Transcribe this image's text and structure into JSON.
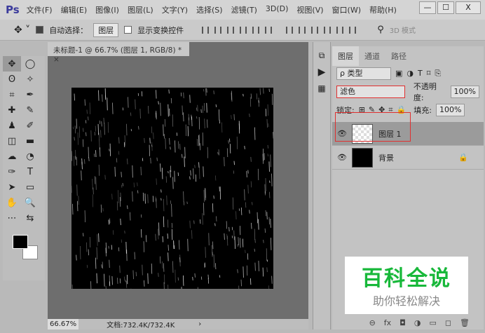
{
  "app": {
    "logo": "Ps"
  },
  "menu": [
    "文件(F)",
    "编辑(E)",
    "图像(I)",
    "图层(L)",
    "文字(Y)",
    "选择(S)",
    "滤镜(T)",
    "3D(D)",
    "视图(V)",
    "窗口(W)",
    "帮助(H)"
  ],
  "window": {
    "minimize": "—",
    "maximize": "☐",
    "close": "X"
  },
  "options": {
    "auto_select_label": "自动选择：",
    "auto_select_value": "图层",
    "show_transform_label": "显示变换控件",
    "mode_3d": "3D 模式"
  },
  "document": {
    "tab_title": "未标题-1 @ 66.7% (图层 1, RGB/8) *",
    "close": "×",
    "zoom": "66.67%",
    "doc_info": "文档:732.4K/732.4K",
    "arrow": "›"
  },
  "tools": [
    "✥",
    "◯",
    "ʘ",
    "✧",
    "⌗",
    "✒",
    "✚",
    "✎",
    "♟",
    "✐",
    "◫",
    "▬",
    "☁",
    "◔",
    "✑",
    "T",
    "➤",
    "▭",
    "✋",
    "🔍",
    "⋯",
    "⇆"
  ],
  "panel": {
    "tabs": [
      "图层",
      "通道",
      "路径"
    ],
    "filter_label": "ρ 类型",
    "blend_mode": "滤色",
    "opacity_label": "不透明度:",
    "opacity": "100%",
    "lock_label": "锁定:",
    "fill_label": "填充:",
    "fill": "100%",
    "layers": [
      {
        "name": "图层 1",
        "selected": true
      },
      {
        "name": "背景",
        "locked": true
      }
    ],
    "footer_icons": [
      "link-icon",
      "fx-icon",
      "mask-icon",
      "adjustment-icon",
      "folder-icon",
      "new-layer-icon",
      "trash-icon"
    ],
    "footer_glyphs": [
      "⊖",
      "fx",
      "◘",
      "◑",
      "▭",
      "◻",
      "🗑"
    ]
  },
  "watermark": {
    "line1": "百科全说",
    "line2": "助你轻松解决"
  },
  "colors": {
    "highlight": "#e03030",
    "watermark_green": "#18b83a"
  }
}
